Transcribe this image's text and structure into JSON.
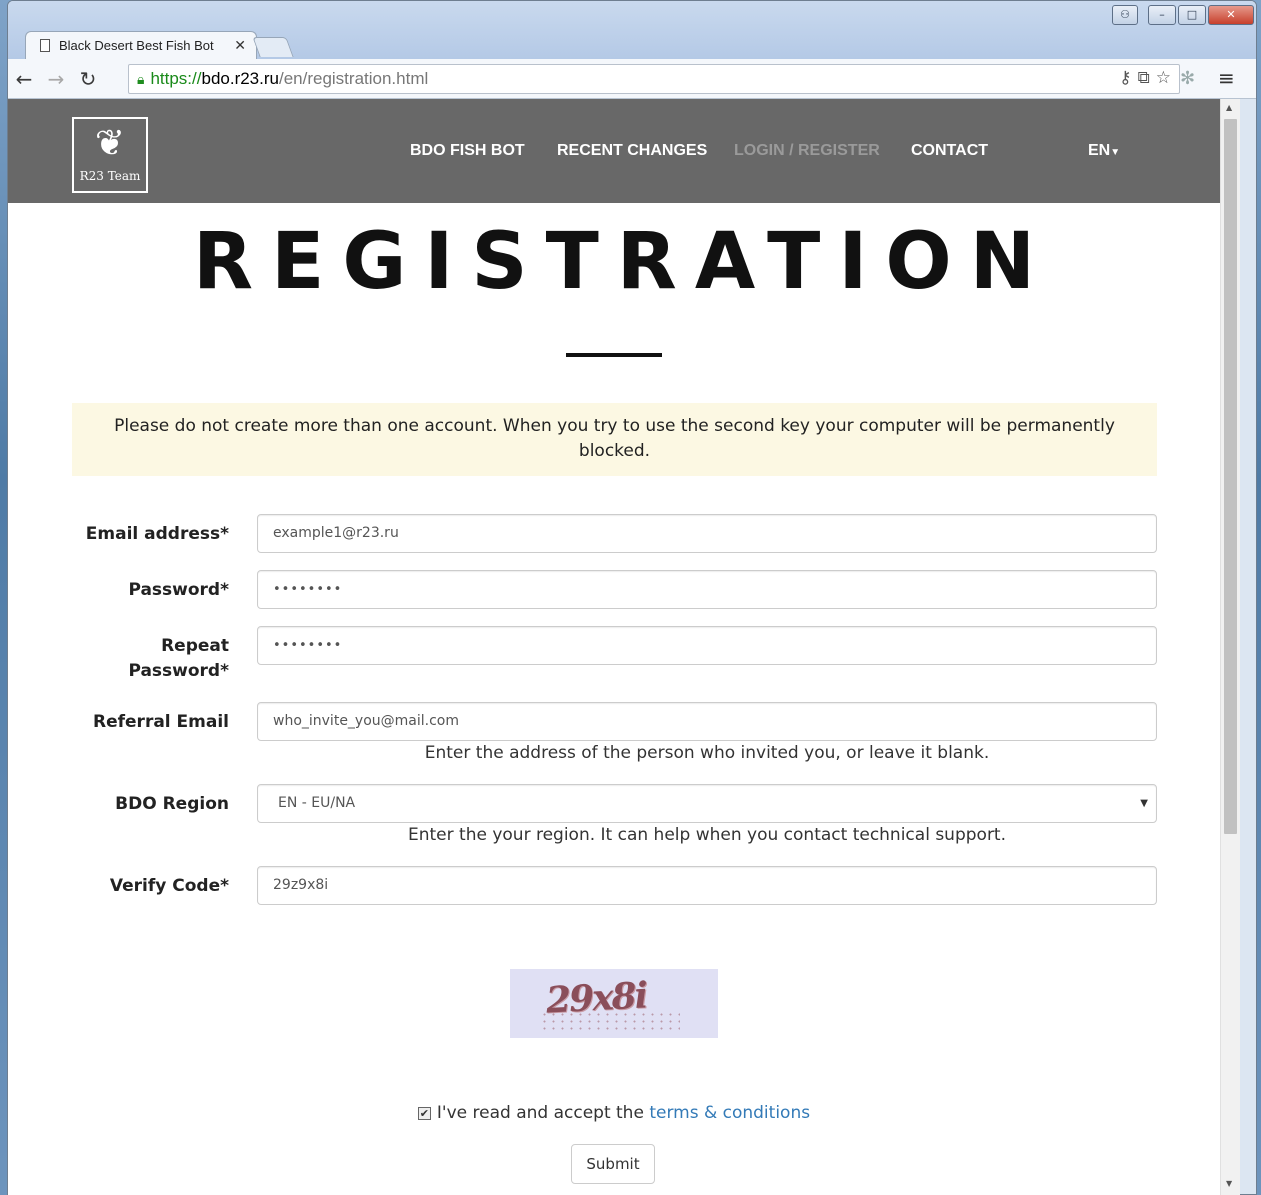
{
  "browser": {
    "tab_title": "Black Desert Best Fish Bot",
    "tab_close": "✕",
    "url_scheme": "https://",
    "url_host": "bdo.r23.ru",
    "url_path": "/en/registration.html",
    "back": "←",
    "forward": "→",
    "reload": "↻",
    "menu": "≡"
  },
  "site": {
    "logo_text": "R23 Team",
    "nav": {
      "fish_bot": "BDO FISH BOT",
      "recent_changes": "RECENT CHANGES",
      "login_register": "LOGIN / REGISTER",
      "contact": "CONTACT",
      "language": "EN"
    }
  },
  "page": {
    "title": "REGISTRATION",
    "notice": "Please do not create more than one account. When you try to use the second key your computer will be permanently blocked."
  },
  "form": {
    "email_label": "Email address*",
    "email_value": "example1@r23.ru",
    "password_label": "Password*",
    "password_value": "••••••••",
    "repeat_label_line1": "Repeat",
    "repeat_label_line2": "Password*",
    "repeat_value": "••••••••",
    "referral_label": "Referral Email",
    "referral_value": "who_invite_you@mail.com",
    "referral_help": "Enter the address of the person who invited you, or leave it blank.",
    "region_label": "BDO Region",
    "region_value": "EN - EU/NA",
    "region_help": "Enter the your region. It can help when you contact technical support.",
    "verify_label": "Verify Code*",
    "verify_value": "29z9x8i",
    "captcha_text": "29x8i",
    "terms_prefix": "I've read and accept the ",
    "terms_link": "terms & conditions",
    "submit": "Submit"
  },
  "colors": {
    "header_bg": "#686868",
    "notice_bg": "#fcf8e3",
    "link": "#337ab7",
    "active_nav": "#9a9a9a"
  }
}
